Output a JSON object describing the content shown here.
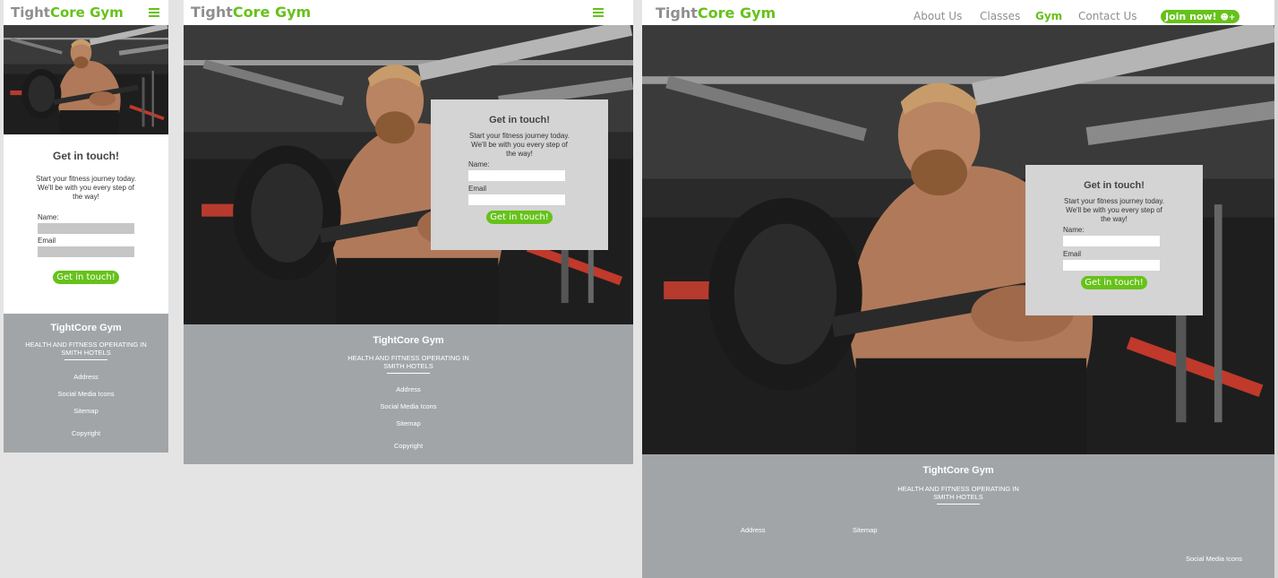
{
  "brand": {
    "part1": "Tight",
    "part2": "Core Gym"
  },
  "nav": {
    "about": "About Us",
    "classes": "Classes",
    "gym": "Gym",
    "contact": "Contact Us",
    "join": "Join now!"
  },
  "form": {
    "title": "Get in touch!",
    "intro": "Start your fitness journey today. We'll be with you every step of the way!",
    "name_label": "Name:",
    "email_label": "Email",
    "submit": "Get in touch!"
  },
  "footer": {
    "title": "TightCore Gym",
    "tagline_1": "HEALTH AND FITNESS OPERATING IN",
    "tagline_2": "SMITH HOTELS",
    "address": "Address",
    "social": "Social Media Icons",
    "sitemap": "Sitemap",
    "copyright": "Copyright"
  },
  "icons": {
    "menu": "hamburger-menu-icon",
    "join": "user-plus-icon"
  },
  "colors": {
    "accent": "#66c21a",
    "logo_grey": "#8f8f8f",
    "footer_bg": "#a2a5a8",
    "form_panel": "#d4d4d4",
    "page_bg": "#e4e4e4"
  }
}
